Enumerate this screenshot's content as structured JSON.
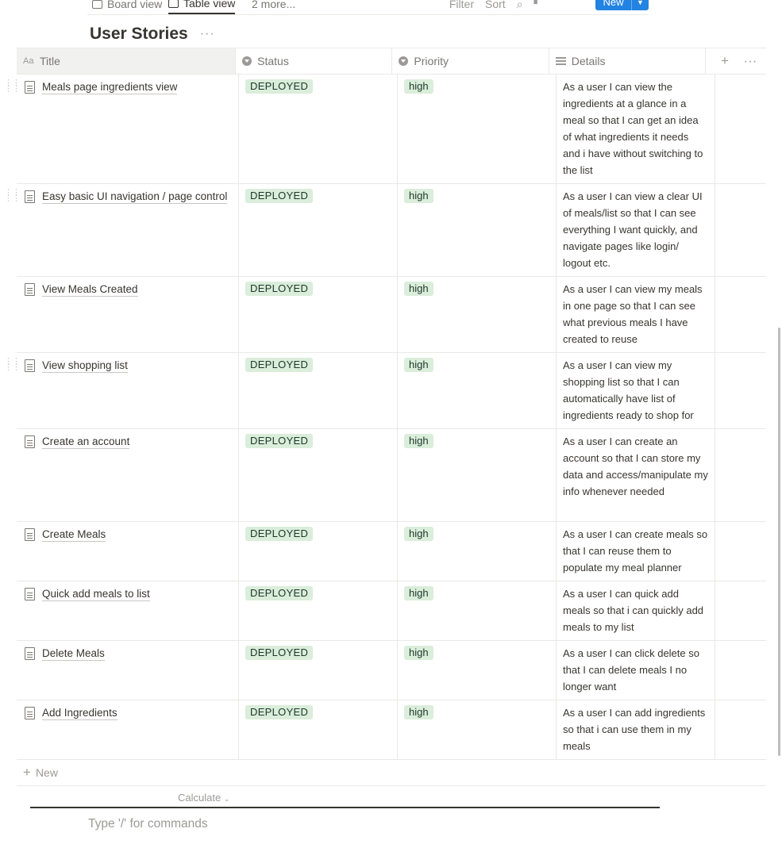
{
  "views": {
    "tabs": [
      {
        "label": "Board view",
        "active": false
      },
      {
        "label": "Table view",
        "active": true
      },
      {
        "label": "2 more..."
      }
    ],
    "filter_label": "Filter",
    "sort_label": "Sort",
    "new_label": "New"
  },
  "database": {
    "title": "User Stories",
    "more": "···"
  },
  "columns": [
    {
      "name": "Title",
      "icon": "text-property-icon"
    },
    {
      "name": "Status",
      "icon": "select-property-icon"
    },
    {
      "name": "Priority",
      "icon": "select-property-icon"
    },
    {
      "name": "Details",
      "icon": "text-lines-icon"
    }
  ],
  "header_actions": {
    "add": "+",
    "more": "···"
  },
  "rows": [
    {
      "title": "Meals page ingredients view",
      "status": "DEPLOYED",
      "priority": "high",
      "details": "As a user I can view the ingredients at a glance in a meal so that I can get an idea of what ingredients it needs and i have without switching to the list"
    },
    {
      "title": "Easy basic UI navigation / page control",
      "status": "DEPLOYED",
      "priority": "high",
      "details": "As a user I can view a clear UI of meals/list so that I can see everything I want quickly, and navigate pages like login/ logout etc."
    },
    {
      "title": "View Meals Created",
      "status": "DEPLOYED",
      "priority": "high",
      "details": "As a user I can view my meals in one  page so that I can see what previous meals I have created to reuse"
    },
    {
      "title": "View shopping list",
      "status": "DEPLOYED",
      "priority": "high",
      "details": "As a user I can view my shopping list so that I can automatically have list of ingredients ready to shop for"
    },
    {
      "title": "Create an account",
      "status": "DEPLOYED",
      "priority": "high",
      "details": "As a user I can create an account so that I can store my data and access/manipulate my info whenever needed"
    },
    {
      "title": "Create Meals",
      "status": "DEPLOYED",
      "priority": "high",
      "details": "As a user I can create meals so that I can reuse them to populate my meal planner"
    },
    {
      "title": "Quick add meals to list",
      "status": "DEPLOYED",
      "priority": "high",
      "details": "As a user I can quick add meals so that i can quickly add meals to my list"
    },
    {
      "title": "Delete Meals",
      "status": "DEPLOYED",
      "priority": "high",
      "details": "As a user I can click delete so that I can delete meals I no longer want"
    },
    {
      "title": "Add Ingredients",
      "status": "DEPLOYED",
      "priority": "high",
      "details": "As a user I can add ingredients so that i can use them in my meals"
    }
  ],
  "new_row_label": "New",
  "calculate_label": "Calculate",
  "editor_placeholder": "Type '/' for commands"
}
